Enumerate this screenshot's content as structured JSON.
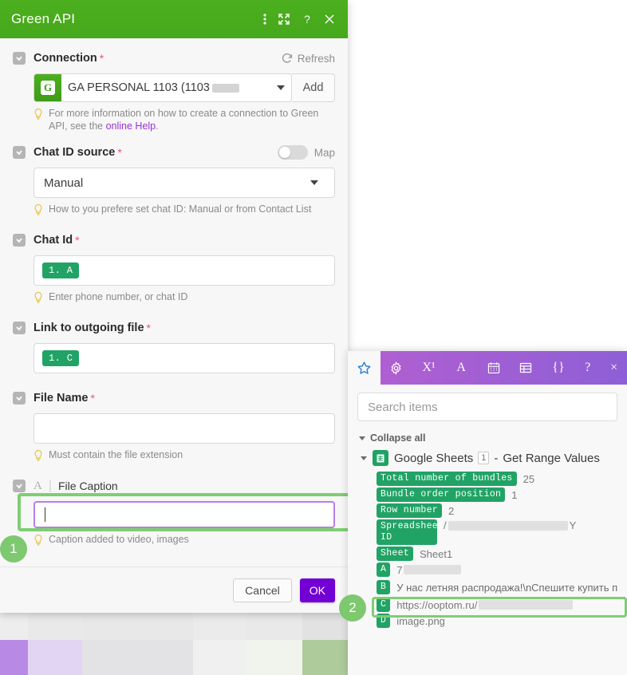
{
  "dialog": {
    "title": "Green API",
    "titlebar_icons": [
      "more-vertical-icon",
      "expand-icon",
      "help-icon",
      "close-icon"
    ],
    "fields": {
      "connection": {
        "label": "Connection",
        "required": "*",
        "refresh_label": "Refresh",
        "value": "GA PERSONAL 1103 (1103",
        "add_label": "Add",
        "hint": "For more information on how to create a connection to Green API, see the ",
        "hint_link": "online Help",
        "hint_tail": "."
      },
      "chat_id_source": {
        "label": "Chat ID source",
        "required": "*",
        "map_label": "Map",
        "value": "Manual",
        "hint": "How to you prefere set chat ID: Manual or from Contact List"
      },
      "chat_id": {
        "label": "Chat Id",
        "required": "*",
        "value": "1. A",
        "hint": "Enter phone number, or chat ID"
      },
      "link_to_outgoing_file": {
        "label": "Link to outgoing file",
        "required": "*",
        "value": "1. C"
      },
      "file_name": {
        "label": "File Name",
        "required": "*",
        "value": "",
        "hint": "Must contain the file extension"
      },
      "file_caption": {
        "type_icon": "A",
        "label": "File Caption",
        "value": "",
        "hint": "Caption added to video, images"
      }
    },
    "footer": {
      "cancel_label": "Cancel",
      "ok_label": "OK"
    }
  },
  "annotations": {
    "step_one": "1",
    "step_two": "2"
  },
  "panel": {
    "tabs": [
      {
        "name": "favorites-tab",
        "glyph": "star-icon",
        "active": true
      },
      {
        "name": "settings-tab",
        "glyph": "gear-icon",
        "active": false
      },
      {
        "name": "formula-tab",
        "glyph": "X¹",
        "active": false
      },
      {
        "name": "text-tab",
        "glyph": "A",
        "active": false
      },
      {
        "name": "calendar-tab",
        "glyph": "calendar-icon",
        "active": false
      },
      {
        "name": "table-tab",
        "glyph": "table-icon",
        "active": false
      },
      {
        "name": "code-tab",
        "glyph": "{}",
        "active": false
      }
    ],
    "help_label": "?",
    "close_label": "×",
    "search_placeholder": "Search items",
    "collapse_all_label": "Collapse all",
    "node": {
      "title": "Google Sheets",
      "count": "1",
      "separator": "-",
      "operation": "Get Range Values"
    },
    "items": [
      {
        "key": "Total number of bundles",
        "value": "25",
        "redacted": false,
        "highlight": false
      },
      {
        "key": "Bundle order position",
        "value": "1",
        "redacted": false,
        "highlight": false
      },
      {
        "key": "Row number",
        "value": "2",
        "redacted": false,
        "highlight": false
      },
      {
        "key": "Spreadsheet\nID",
        "value": "/",
        "redacted": true,
        "redact_width": 150,
        "tail": "Y",
        "highlight": false
      },
      {
        "key": "Sheet",
        "value": "Sheet1",
        "redacted": false,
        "highlight": false
      },
      {
        "key": "A",
        "value": "7",
        "redacted": true,
        "redact_width": 72,
        "highlight": false
      },
      {
        "key": "B",
        "value": "У нас летняя распродажа!\\nСпешите купить по",
        "redacted": false,
        "highlight": true
      },
      {
        "key": "C",
        "value": "https://ooptom.ru/",
        "redacted": true,
        "redact_width": 118,
        "highlight": false
      },
      {
        "key": "D",
        "value": "image.png",
        "redacted": false,
        "highlight": false
      }
    ]
  },
  "colors": {
    "brand_green": "#4caf1e",
    "tag_green": "#21a366",
    "accent_purple": "#7200d4",
    "panel_purple": "#8e5fd6",
    "highlight_green": "#7ece72",
    "required_red": "#e8566f",
    "link_purple": "#9b2fd4"
  },
  "decor": {
    "row1": [
      "#ededed",
      "#e9e9e9",
      "#e8e8e8",
      "#e8e8e8",
      "#ebebeb",
      "#e9e9e9",
      "#e2e2e2"
    ],
    "row2": [
      "#b98ae5",
      "#e2d4f3",
      "#e3e3e5",
      "#e3e3e5",
      "#f0f0f0",
      "#f0f4ec",
      "#aecb9b"
    ],
    "widths": [
      35,
      68,
      69,
      70,
      67,
      70,
      57
    ]
  }
}
